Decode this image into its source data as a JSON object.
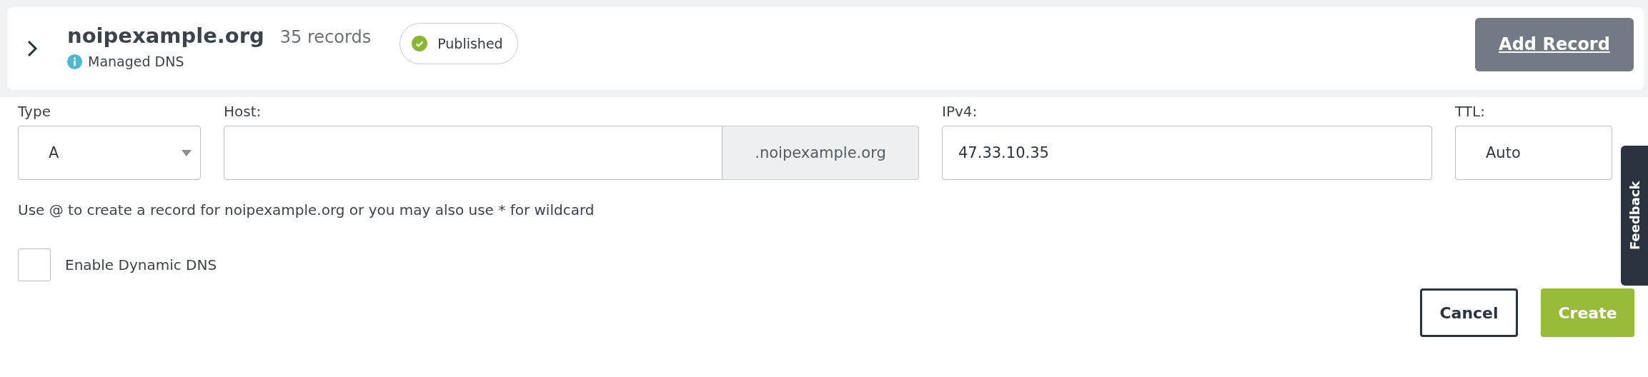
{
  "domain": {
    "name": "noipexample.org",
    "record_count": "35 records",
    "expanded": false,
    "type_label": "Managed DNS",
    "status": "Published"
  },
  "add_record_button": "Add Record",
  "form": {
    "type": {
      "label": "Type",
      "value": "A"
    },
    "host": {
      "label": "Host:",
      "suffix": ".noipexample.org"
    },
    "ipv4": {
      "label": "IPv4:",
      "value": "47.33.10.35"
    },
    "ttl": {
      "label": "TTL:",
      "value": "Auto"
    },
    "hint": "Use @ to create a record for noipexample.org or you may also use * for wildcard",
    "dynamic_dns": {
      "label": "Enable Dynamic DNS",
      "checked": false
    }
  },
  "buttons": [
    {
      "label": "Cancel",
      "kind": "secondary"
    },
    {
      "label": "Create",
      "kind": "primary"
    }
  ],
  "feedback_tab": "Feedback"
}
